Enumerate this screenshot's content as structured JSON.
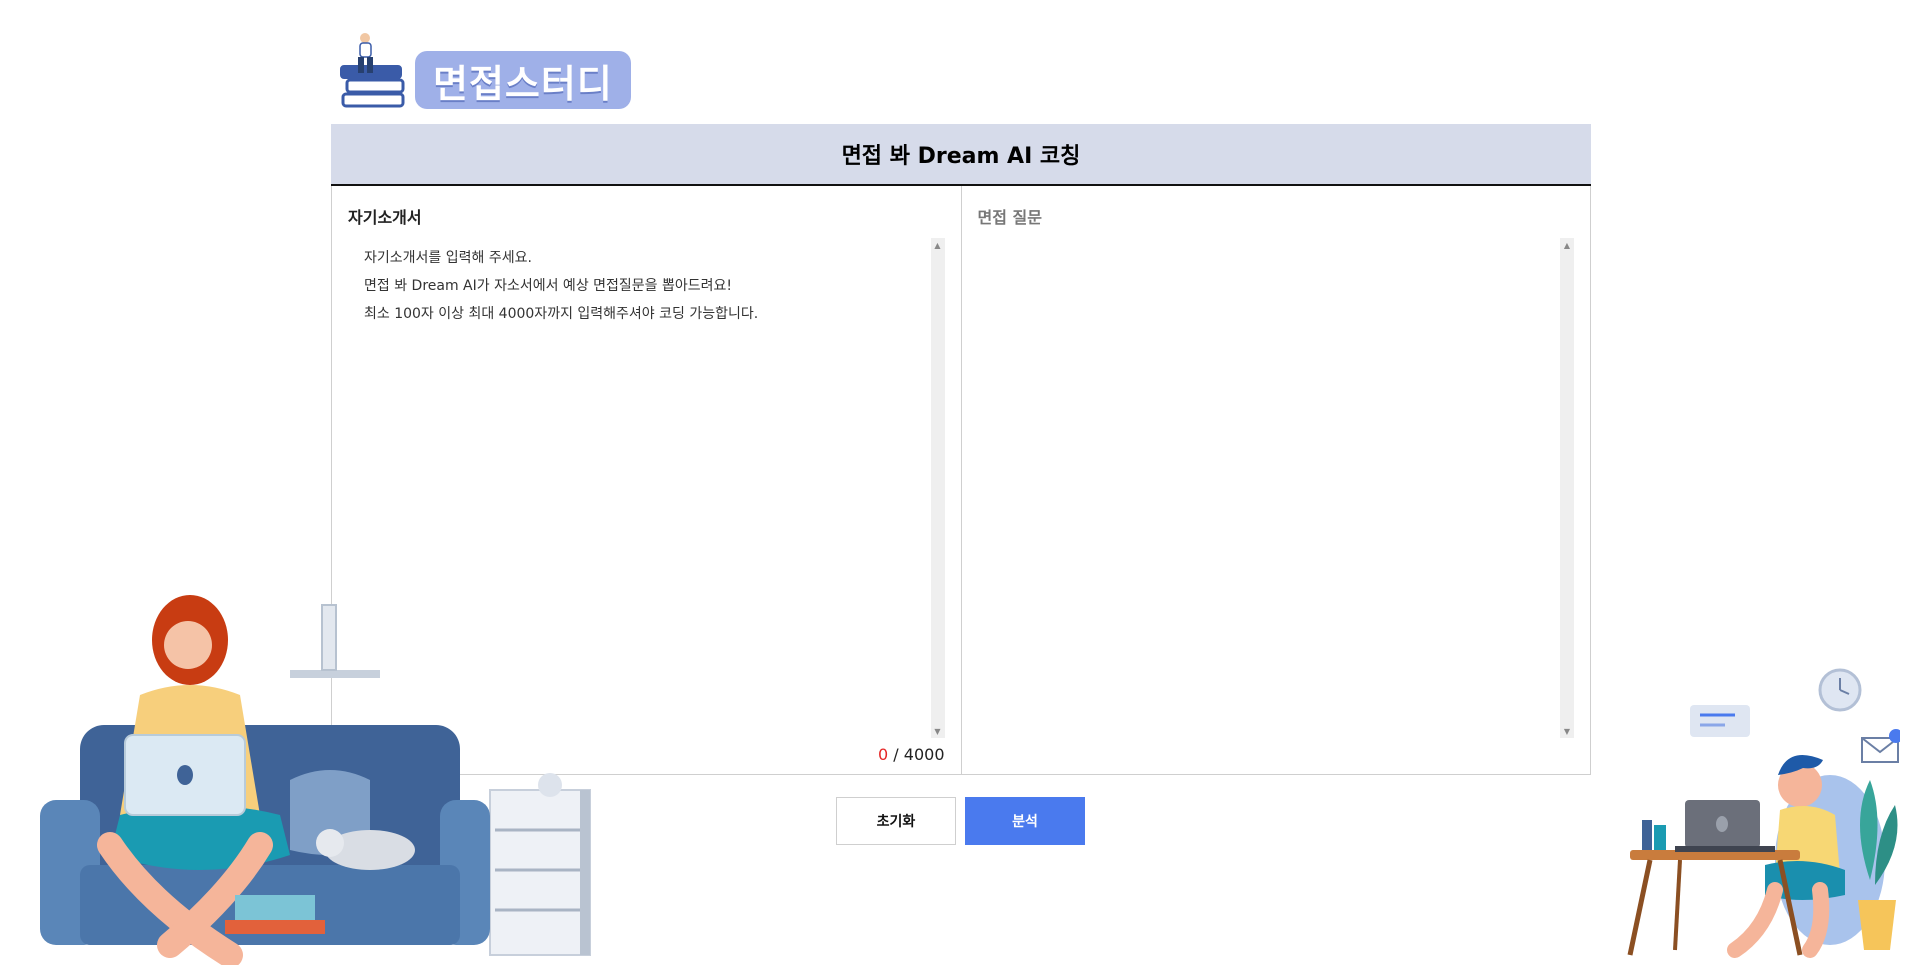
{
  "brand": {
    "logo_text": "면접스터디"
  },
  "panel": {
    "title": "면접 봐 Dream AI 코칭",
    "left": {
      "title": "자기소개서",
      "placeholder": "자기소개서를 입력해 주세요.\n면접 봐 Dream AI가 자소서에서 예상 면접질문을 뽑아드려요!\n최소 100자 이상 최대 4000자까지 입력해주셔야 코딩 가능합니다.",
      "value": "",
      "char_count": "0",
      "char_separator": "/",
      "char_limit": "4000"
    },
    "right": {
      "title": "면접 질문",
      "value": ""
    }
  },
  "buttons": {
    "reset": "초기화",
    "analyze": "분석"
  },
  "colors": {
    "header_bg": "#d6dbea",
    "accent": "#4a7aee",
    "counter_current": "#e52727",
    "logo_bg": "#9fb0e8"
  },
  "icons": {
    "logo": "books-with-person-icon",
    "scroll_up": "scroll-up-arrow-icon",
    "scroll_down": "scroll-down-arrow-icon"
  }
}
